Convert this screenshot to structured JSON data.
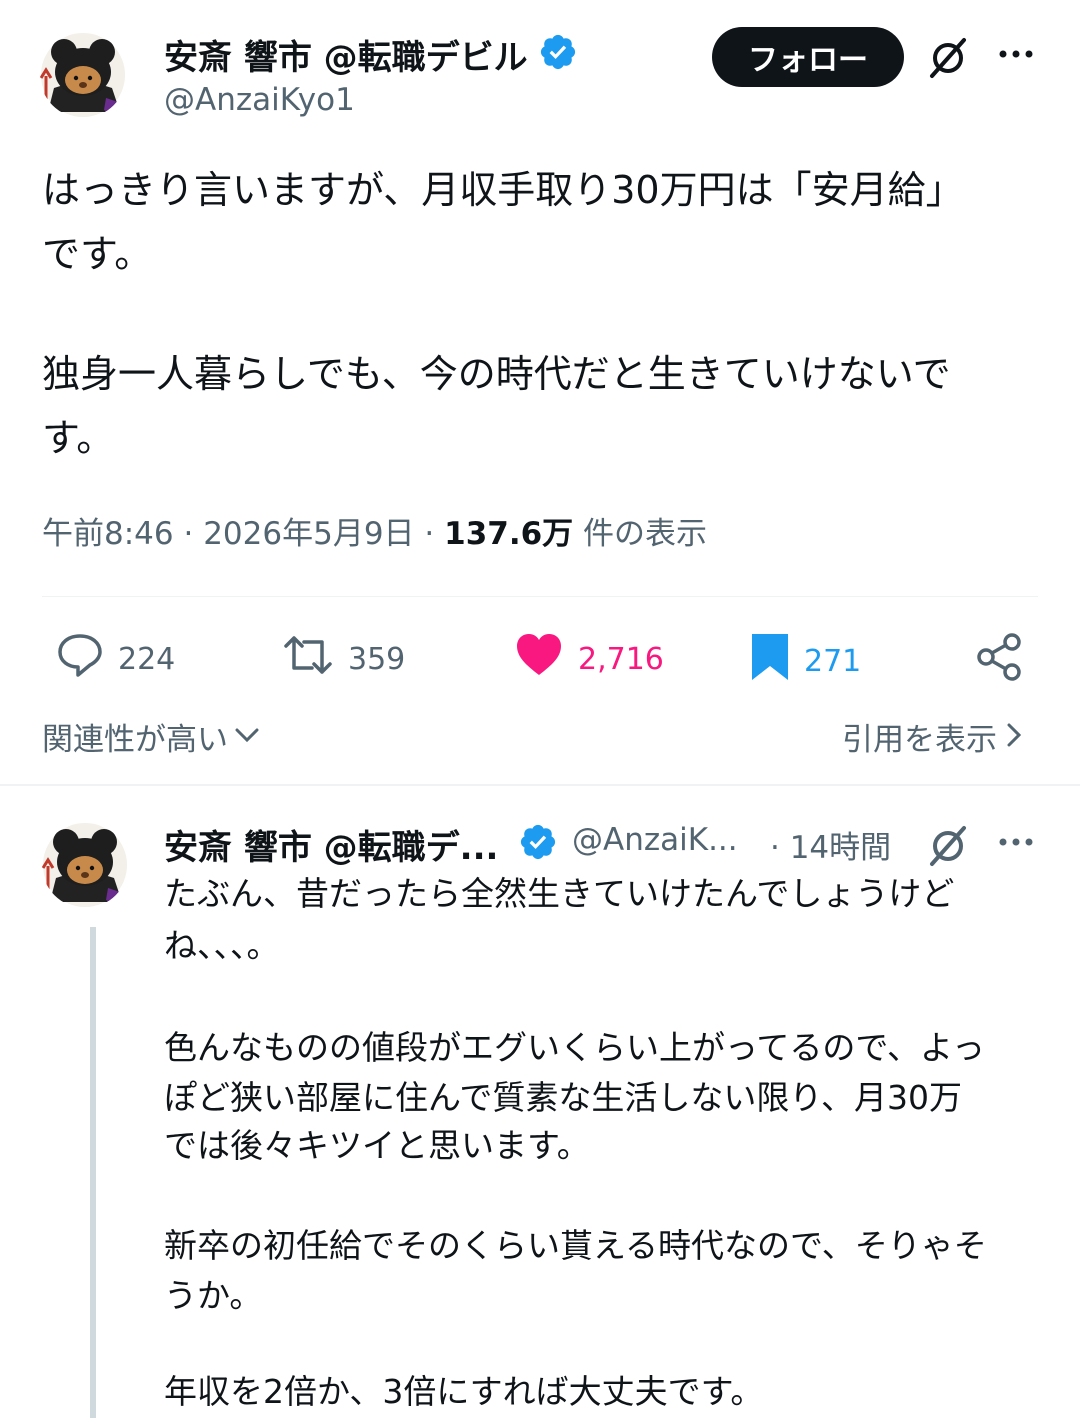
{
  "main_tweet": {
    "author_name": "安斎 響市 @転職デビル",
    "handle": "@AnzaiKyo1",
    "follow_label": "フォロー",
    "text_lines": [
      "はっきり言いますが、月収手取り30万円は「安月給」",
      "です。",
      "独身一人暮らしでも、今の時代だと生きていけないで",
      "す。"
    ],
    "time": "午前8:46",
    "date": "2026年5月9日",
    "views_count": "137.6万",
    "views_label": "件の表示",
    "replies": "224",
    "reposts": "359",
    "likes": "2,716",
    "bookmarks": "271"
  },
  "sort": {
    "relevance_label": "関連性が高い",
    "quotes_label": "引用を表示"
  },
  "reply": {
    "author_name": "安斎 響市 @転職デ...",
    "handle": "@AnzaiK...",
    "time_ago": "· 14時間",
    "text_lines": [
      "たぶん、昔だったら全然生きていけたんでしょうけど",
      "ね、、、。",
      "色んなものの値段がエグいくらい上がってるので、よっ",
      "ぽど狭い部屋に住んで質素な生活しない限り、月30万",
      "では後々キツイと思います。",
      "新卒の初任給でそのくらい貰える時代なので、そりゃそ",
      "うか。",
      "年収を2倍か、3倍にすれば大丈夫です。"
    ]
  },
  "colors": {
    "verified": "#1d9bf0",
    "like": "#f91880",
    "bookmark": "#1d9bf0",
    "muted": "#536471"
  },
  "icons": [
    "grok-icon",
    "more-icon",
    "verified-badge-icon",
    "reply-icon",
    "repost-icon",
    "like-icon",
    "bookmark-icon",
    "share-icon",
    "chevron-down-icon",
    "chevron-right-icon"
  ]
}
